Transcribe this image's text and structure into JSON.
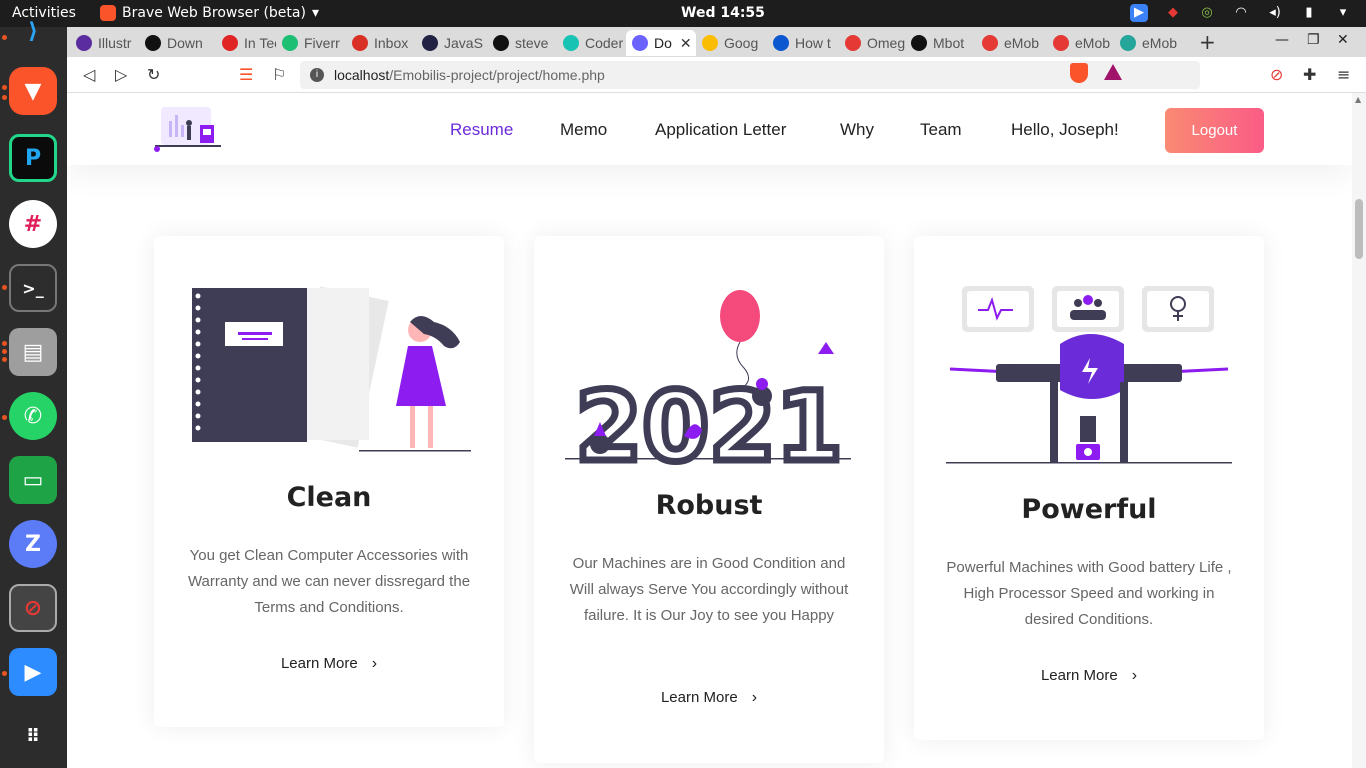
{
  "topbar": {
    "activities": "Activities",
    "app_name": "Brave Web Browser (beta)",
    "clock": "Wed 14:55"
  },
  "browser": {
    "tabs": [
      {
        "label": "Illustr",
        "favicon_color": "#5b2ca0"
      },
      {
        "label": "Down",
        "favicon_color": "#111111"
      },
      {
        "label": "In Tec",
        "favicon_color": "#e02424"
      },
      {
        "label": "Fiverr",
        "favicon_color": "#1dbf73"
      },
      {
        "label": "Inbox",
        "favicon_color": "#d93025"
      },
      {
        "label": "JavaS",
        "favicon_color": "#222244"
      },
      {
        "label": "steve",
        "favicon_color": "#111111"
      },
      {
        "label": "Coder",
        "favicon_color": "#17c3b2"
      },
      {
        "label": "Do",
        "favicon_color": "#6c63ff"
      },
      {
        "label": "Goog",
        "favicon_color": "#fbbc04"
      },
      {
        "label": "How t",
        "favicon_color": "#0b57d0"
      },
      {
        "label": "Omeg",
        "favicon_color": "#e53935"
      },
      {
        "label": "Mbot",
        "favicon_color": "#111111"
      },
      {
        "label": "eMob",
        "favicon_color": "#e53935"
      },
      {
        "label": "eMob",
        "favicon_color": "#e53935"
      },
      {
        "label": "eMob",
        "favicon_color": "#26a69a"
      }
    ],
    "url_host": "localhost",
    "url_path": "/Emobilis-project/project/home.php"
  },
  "site": {
    "nav": [
      "Resume",
      "Memo",
      "Application Letter",
      "Why",
      "Team",
      "Hello, Joseph!"
    ],
    "logout": "Logout",
    "cards": [
      {
        "title": "Clean",
        "text": "You get Clean Computer Accessories with Warranty and we can never dissregard the Terms and Conditions.",
        "link": "Learn More"
      },
      {
        "title": "Robust",
        "text": "Our Machines are in Good Condition and Will always Serve You accordingly without failure. It is Our Joy to see you Happy",
        "link": "Learn More",
        "illustration_text": "2021"
      },
      {
        "title": "Powerful",
        "text": "Powerful Machines with Good battery Life , High Processor Speed and working in desired Conditions.",
        "link": "Learn More"
      }
    ]
  },
  "colors": {
    "accent": "#6c2bd9",
    "logout_start": "#f98a73",
    "logout_end": "#fb5c86",
    "illustration_dark": "#3f3d56",
    "illustration_purple": "#8c1cf0"
  }
}
